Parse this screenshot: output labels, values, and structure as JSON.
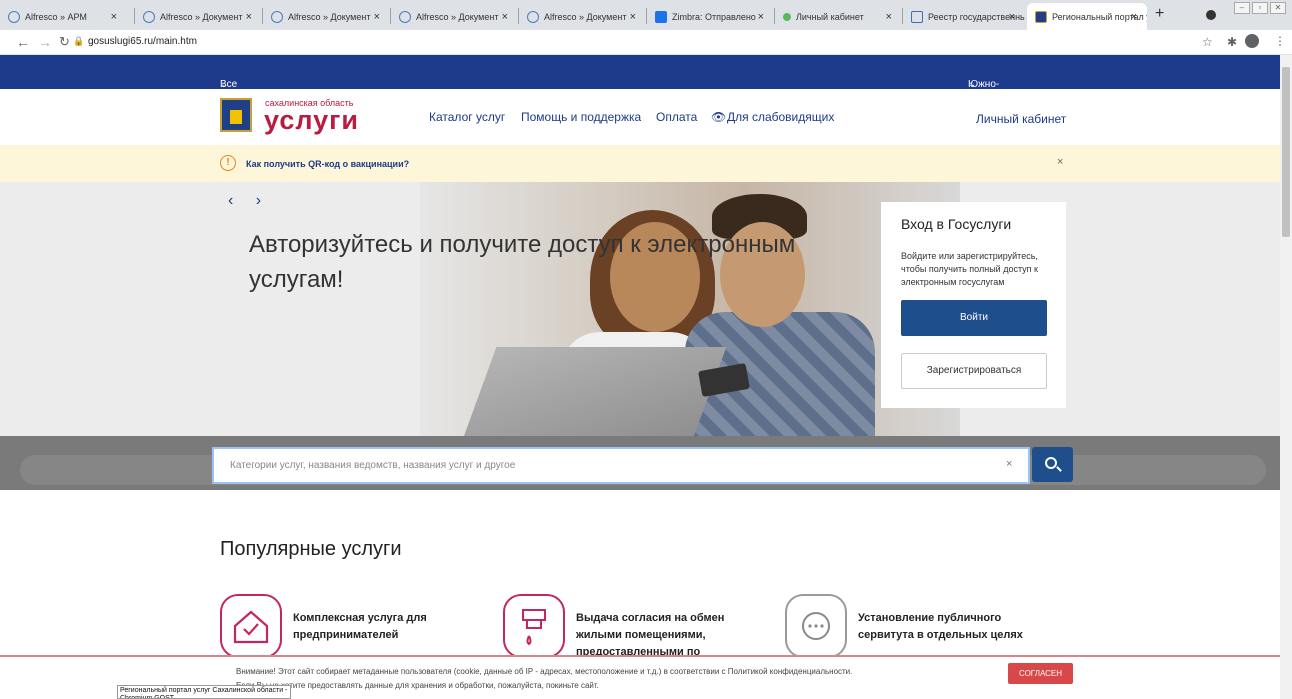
{
  "tabs": [
    {
      "label": "Alfresco » АРМ"
    },
    {
      "label": "Alfresco » Документ"
    },
    {
      "label": "Alfresco » Документ"
    },
    {
      "label": "Alfresco » Документ"
    },
    {
      "label": "Alfresco » Документ"
    },
    {
      "label": "Zimbra: Отправлено"
    },
    {
      "label": "Личный кабинет"
    },
    {
      "label": "Реестр государственны"
    },
    {
      "label": "Региональный портал у"
    }
  ],
  "address": {
    "url": "gosuslugi65.ru/main.htm"
  },
  "topbar": {
    "categories": "Все категории",
    "city": "Южно-Сахалинск"
  },
  "logo": {
    "region": "сахалинская область",
    "name": "услуги"
  },
  "nav": {
    "catalog": "Каталог услуг",
    "help": "Помощь и поддержка",
    "payment": "Оплата",
    "accessible": "Для слабовидящих",
    "cabinet": "Личный кабинет"
  },
  "alert": {
    "text": "Как получить QR-код о вакцинации?",
    "close": "×"
  },
  "hero": {
    "text": "Авторизуйтесь и получите доступ к электронным услугам!",
    "prev": "‹",
    "next": "›"
  },
  "login": {
    "title": "Вход в Госуслуги",
    "desc": "Войдите или зарегистрируйтесь, чтобы получить полный доступ к электронным госуслугам",
    "login_btn": "Войти",
    "register_btn": "Зарегистрироваться"
  },
  "search": {
    "placeholder": "Категории услуг, названия ведомств, названия услуг и другое",
    "clear": "×"
  },
  "popular": {
    "title": "Популярные услуги",
    "items": [
      {
        "label": "Комплексная услуга для\nпредпринимателей"
      },
      {
        "label": "Выдача согласия на обмен\nжилыми помещениями,\nпредоставленными по"
      },
      {
        "label": "Установление публичного\nсервитута в отдельных целях"
      }
    ]
  },
  "cookie": {
    "line1": "Внимание! Этот сайт собирает метаданные пользователя (cookie, данные об IP - адресах, местоположение и т.д.) в соответствии с Политикой конфиденциальности.",
    "line2": "Если Вы не хотите предоставлять данные для хранения и обработки, пожалуйста, покиньте сайт.",
    "agree": "СОГЛАСЕН"
  },
  "statusbar": {
    "text": "Региональный портал услуг Сахалинской области - Chromium GOST"
  }
}
